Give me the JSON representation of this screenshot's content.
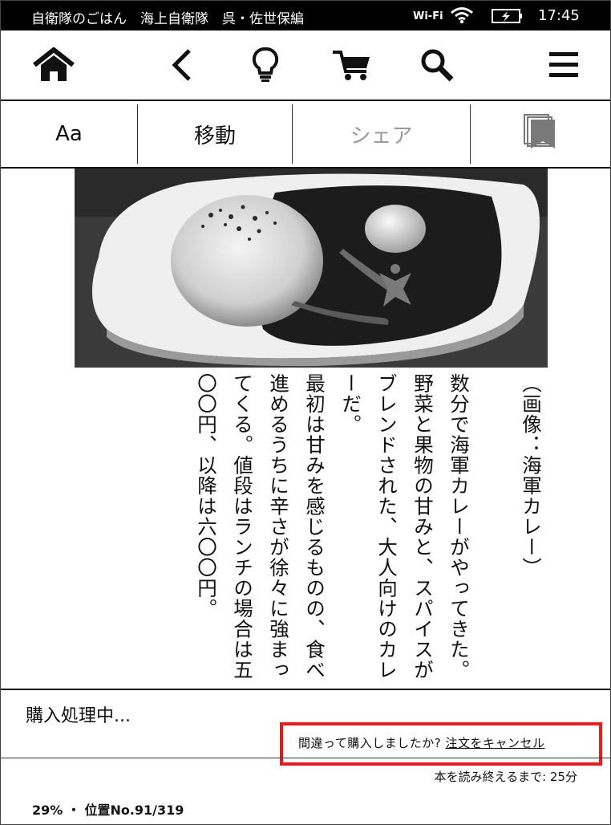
{
  "status_bar": {
    "book_title": "自衛隊のごはん　海上自衛隊　呉・佐世保編",
    "wifi_label": "Wi-Fi",
    "time": "17:45"
  },
  "toolbar": {
    "icons": [
      "home-icon",
      "back-icon",
      "lightbulb-icon",
      "cart-icon",
      "search-icon",
      "menu-icon"
    ]
  },
  "menu_bar": {
    "font_label": "Aa",
    "goto_label": "移動",
    "share_label": "シェア",
    "bookmark_icon": "bookmark-icon"
  },
  "content": {
    "image_caption": "（画像：海軍カレー）",
    "paragraphs": [
      "数分で海軍カレーがやってきた。野菜と果物の甘みと、スパイスがブレンドされた、大人向けのカレーだ。",
      "最初は甘みを感じるものの、食べ進めるうちに辛さが徐々に強まってくる。値段はランチの場合は五〇〇円、以降は六〇〇円。"
    ]
  },
  "purchase": {
    "status": "購入処理中...",
    "question": "間違って購入しましたか?",
    "cancel_link": "注文をキャンセル"
  },
  "progress": {
    "remaining": "本を読み終えるまで: 25分",
    "location": "29% ・ 位置No.91/319"
  },
  "colors": {
    "highlight_box": "#e31d1d",
    "status_bar_bg": "#000000",
    "disabled_text": "#9a9a9a"
  }
}
